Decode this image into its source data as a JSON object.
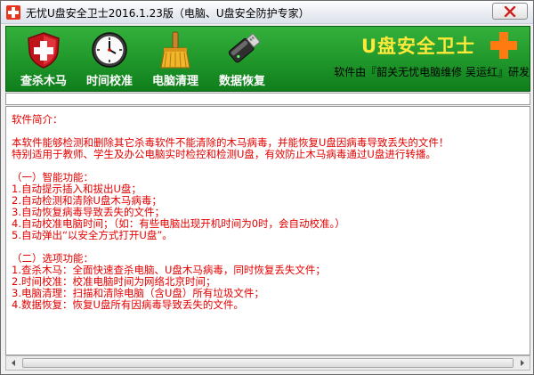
{
  "window": {
    "title": "无忧U盘安全卫士2016.1.23版（电脑、U盘安全防护专家）"
  },
  "toolbar": {
    "items": [
      {
        "label": "查杀木马",
        "icon": "shield-cross-icon"
      },
      {
        "label": "时间校准",
        "icon": "clock-icon"
      },
      {
        "label": "电脑清理",
        "icon": "broom-icon"
      },
      {
        "label": "数据恢复",
        "icon": "usb-drive-icon"
      }
    ]
  },
  "brand": {
    "title": "U盘安全卫士",
    "subtitle": "软件由『韶关无忧电脑维修 吴运红』研发"
  },
  "content": {
    "lines": [
      "软件简介：",
      "",
      "      本软件能够检测和删除其它杀毒软件不能清除的木马病毒，并能恢复U盘因病毒导致丢失的文件！",
      "特别适用于教师、学生及办公电脑实时检控和检测U盘，有效防止木马病毒通过U盘进行转播。",
      "",
      "（一）智能功能：",
      "1.自动提示插入和拔出U盘；",
      "2.自动检测和清除U盘木马病毒；",
      "3.自动恢复病毒导致丢失的文件；",
      "4.自动校准电脑时间；（如：有些电脑出现开机时间为0时，会自动校准。）",
      "5.自动弹出“以安全方式打开U盘”。",
      "",
      "（二）选项功能：",
      "1.查杀木马：全面快速查杀电脑、U盘木马病毒，同时恢复丢失文件；",
      "2.时间校准：校准电脑时间为网络北京时间；",
      "3.电脑清理：扫描和清除电脑（含U盘）所有垃圾文件；",
      "4.数据恢复：恢复U盘所有因病毒导致丢失的文件。"
    ]
  },
  "colors": {
    "toolbar_green": "#239b2d",
    "brand_yellow": "#ffe93a",
    "content_red": "#e40000",
    "cross_orange": "#ff7a10"
  }
}
